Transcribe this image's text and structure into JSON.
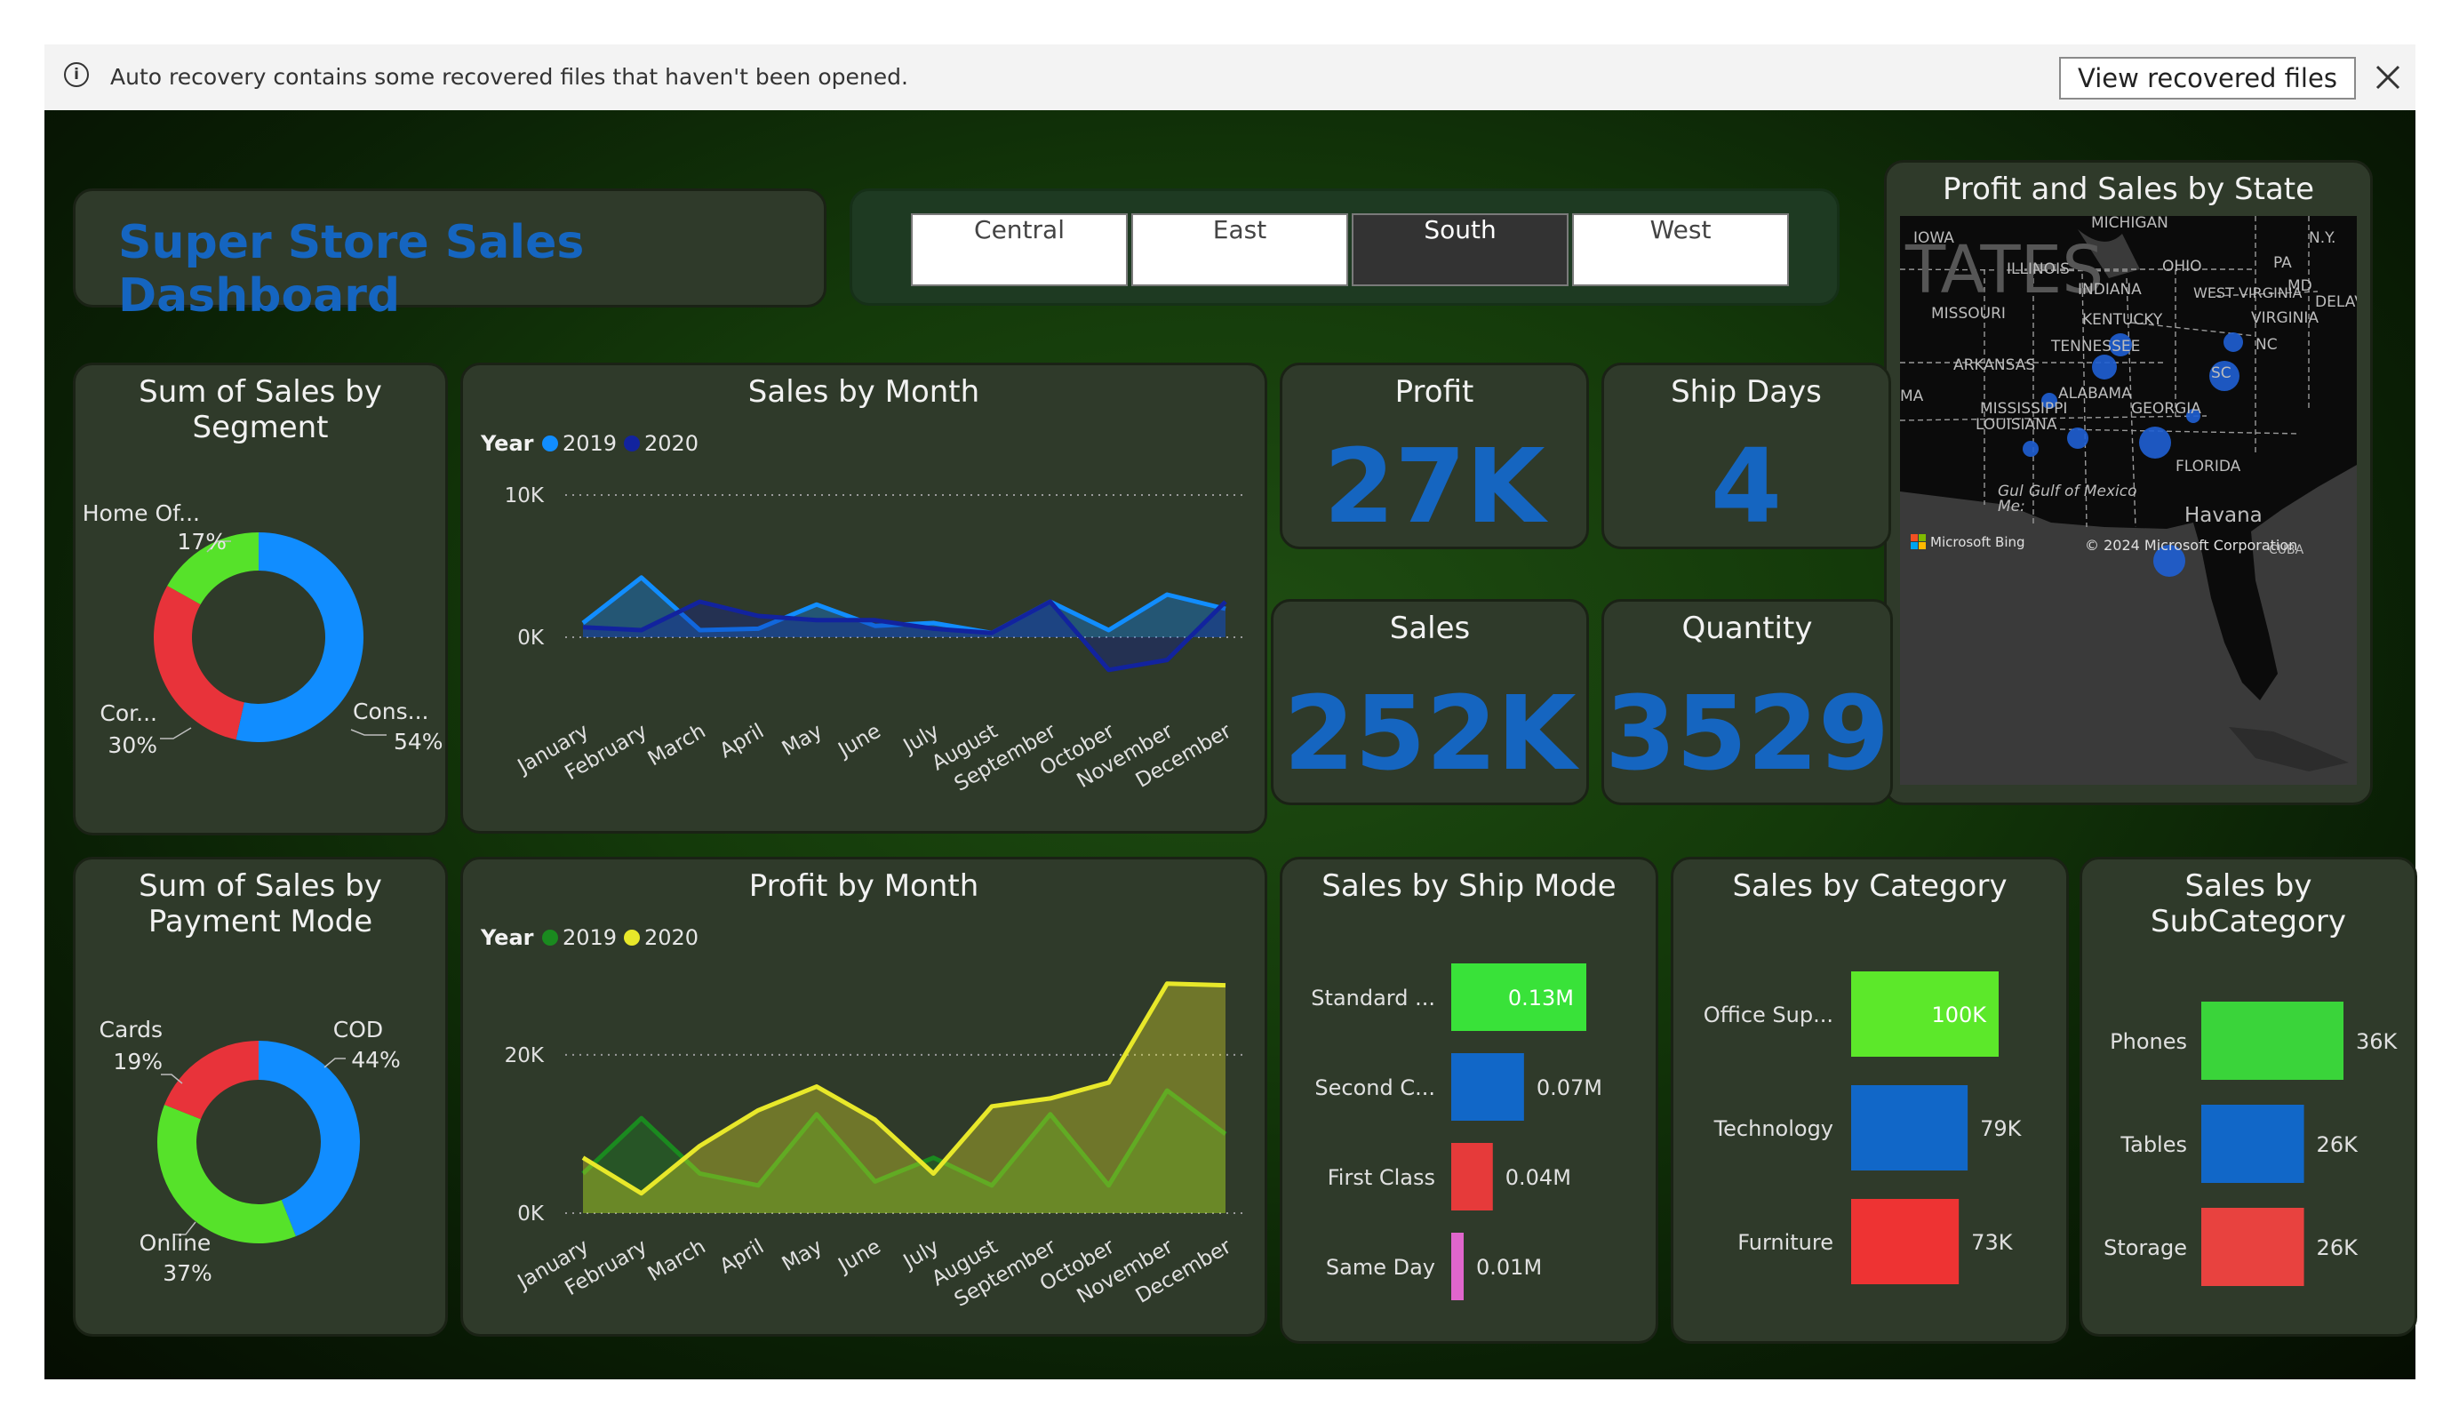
{
  "banner": {
    "message": "Auto recovery contains some recovered files that haven't been opened.",
    "button_label": "View recovered files",
    "info_glyph": "i",
    "close_icon": "close-icon",
    "info_icon": "info-icon"
  },
  "dashboard": {
    "title": "Super Store Sales Dashboard",
    "title_color": "#1565c0",
    "region_slicer": {
      "options": [
        "Central",
        "East",
        "South",
        "West"
      ],
      "selected": "South"
    }
  },
  "kpis": {
    "profit": {
      "label": "Profit",
      "value": "27K"
    },
    "ship_days": {
      "label": "Ship Days",
      "value": "4"
    },
    "sales": {
      "label": "Sales",
      "value": "252K"
    },
    "quantity": {
      "label": "Quantity",
      "value": "3529"
    }
  },
  "map": {
    "title": "Profit and Sales by State",
    "labels": [
      "MICHIGAN",
      "IOWA",
      "N.Y.",
      "OHIO",
      "PA",
      "INDIANA",
      "WEST VIRGINIA",
      "MD",
      "DELAV",
      "MISSOURI",
      "KENTUCKY",
      "VIRGINIA",
      "TENNESSEE",
      "NC",
      "ARKANSAS",
      "SC",
      "ALABAMA",
      "MISSISSIPPI",
      "GEORGIA",
      "LOUISIANA",
      "FLORIDA",
      "Gulf of Mexico",
      "Havana",
      "CUBA",
      "TATES",
      "ILLINOIS",
      "MA"
    ],
    "gulf_prefix": "Gul",
    "gulf_suffix": "Me:",
    "bing": "Microsoft Bing",
    "copyright": "© 2024 Microsoft Corporation"
  },
  "chart_data": [
    {
      "id": "segment",
      "type": "pie",
      "title": "Sum of Sales by Segment",
      "title_lines": [
        "Sum of Sales by",
        "Segment"
      ],
      "slices": [
        {
          "label": "Cons...",
          "pct": "54%",
          "value": 54,
          "color": "#118dff"
        },
        {
          "label": "Cor...",
          "pct": "30%",
          "value": 30,
          "color": "#e8333a"
        },
        {
          "label": "Home Of...",
          "pct": "17%",
          "value": 17,
          "color": "#56e22a"
        }
      ]
    },
    {
      "id": "payment",
      "type": "pie",
      "title": "Sum of Sales by Payment Mode",
      "title_lines": [
        "Sum of Sales by",
        "Payment Mode"
      ],
      "slices": [
        {
          "label": "COD",
          "pct": "44%",
          "value": 44,
          "color": "#118dff"
        },
        {
          "label": "Online",
          "pct": "37%",
          "value": 37,
          "color": "#56e22a"
        },
        {
          "label": "Cards",
          "pct": "19%",
          "value": 19,
          "color": "#e8333a"
        }
      ]
    },
    {
      "id": "sales_month",
      "type": "area",
      "title": "Sales by Month",
      "legend_title": "Year",
      "categories": [
        "January",
        "February",
        "March",
        "April",
        "May",
        "June",
        "July",
        "August",
        "September",
        "October",
        "November",
        "December"
      ],
      "ylim": [
        -2500,
        11000
      ],
      "yticks": [
        {
          "value": 0,
          "label": "0K"
        },
        {
          "value": 10000,
          "label": "10K"
        }
      ],
      "series": [
        {
          "name": "2019",
          "color": "#118dff",
          "values": [
            1000,
            4200,
            500,
            600,
            2300,
            800,
            1000,
            300,
            2500,
            500,
            3000,
            2000
          ]
        },
        {
          "name": "2020",
          "color": "#12239e",
          "values": [
            700,
            500,
            2500,
            1500,
            1200,
            1200,
            600,
            300,
            2500,
            -2300,
            -1600,
            2500
          ]
        }
      ]
    },
    {
      "id": "profit_month",
      "type": "area",
      "title": "Profit by Month",
      "legend_title": "Year",
      "categories": [
        "January",
        "February",
        "March",
        "April",
        "May",
        "June",
        "July",
        "August",
        "September",
        "October",
        "November",
        "December"
      ],
      "ylim": [
        0,
        31000
      ],
      "yticks": [
        {
          "value": 0,
          "label": "0K"
        },
        {
          "value": 20000,
          "label": "20K"
        }
      ],
      "series": [
        {
          "name": "2019",
          "color": "#1a8a1f",
          "values": [
            5000,
            12000,
            5000,
            3500,
            12500,
            4000,
            7000,
            3500,
            12500,
            3500,
            15500,
            10000
          ]
        },
        {
          "name": "2020",
          "color": "#e8e82a",
          "values": [
            7000,
            2500,
            8500,
            13000,
            16000,
            11800,
            5000,
            13500,
            14500,
            16500,
            29000,
            28800
          ]
        }
      ]
    },
    {
      "id": "ship_mode",
      "type": "bar",
      "title": "Sales by Ship Mode",
      "categories": [
        "Standard ...",
        "Second C...",
        "First Class",
        "Same Day"
      ],
      "values": [
        0.13,
        0.07,
        0.04,
        0.01
      ],
      "labels": [
        "0.13M",
        "0.07M",
        "0.04M",
        "0.01M"
      ],
      "colors": [
        "#39e239",
        "#1167c8",
        "#e63a3a",
        "#e066cc"
      ]
    },
    {
      "id": "category",
      "type": "bar",
      "title": "Sales by Category",
      "categories": [
        "Office Sup...",
        "Technology",
        "Furniture"
      ],
      "values": [
        100,
        79,
        73
      ],
      "labels": [
        "100K",
        "79K",
        "73K"
      ],
      "colors": [
        "#5ce82a",
        "#1167c8",
        "#ee3333"
      ]
    },
    {
      "id": "subcategory",
      "type": "bar",
      "title": "Sales by SubCategory",
      "title_lines": [
        "Sales by",
        "SubCategory"
      ],
      "categories": [
        "Phones",
        "Tables",
        "Storage"
      ],
      "values": [
        36,
        26,
        26
      ],
      "labels": [
        "36K",
        "26K",
        "26K"
      ],
      "colors": [
        "#3ad43a",
        "#1167c8",
        "#e8423f"
      ]
    }
  ]
}
